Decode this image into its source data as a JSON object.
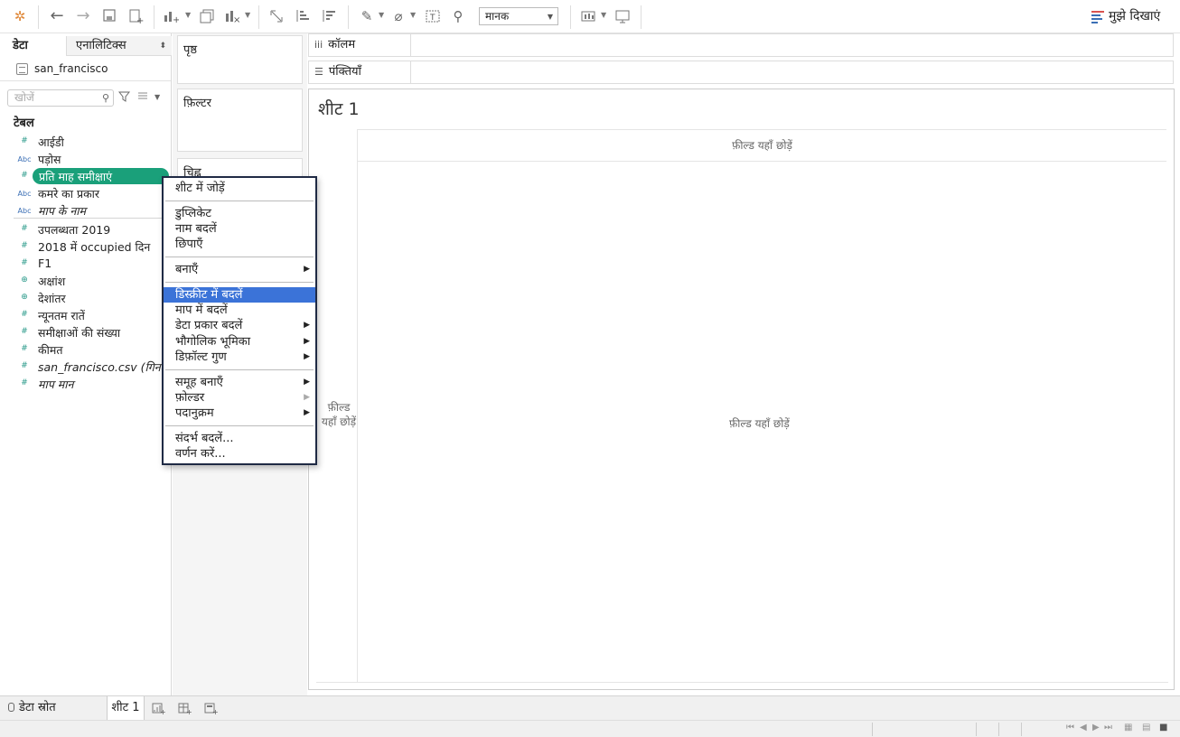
{
  "toolbar": {
    "standard_select": "मानक",
    "show_me_label": "मुझे दिखाएं",
    "icons": [
      "tableau-logo-icon",
      "undo-icon",
      "redo-icon",
      "save-icon",
      "new-datasource-icon",
      "new-worksheet-icon",
      "duplicate-sheet-icon",
      "clear-sheet-icon",
      "swap-icon",
      "sort-ascending-icon",
      "sort-descending-icon",
      "highlight-icon",
      "group-icon",
      "label-icon",
      "pin-icon",
      "fit-icon",
      "presentation-icon"
    ]
  },
  "data_pane": {
    "tab_data": "डेटा",
    "tab_analytics": "एनालिटिक्स",
    "datasource": "san_francisco",
    "search_placeholder": "खोजें",
    "tables_heading": "टेबल",
    "fields": [
      {
        "label": "आईडी",
        "type": "#"
      },
      {
        "label": "पड़ोस",
        "type": "Abc"
      },
      {
        "label": "प्रति माह समीक्षाएं",
        "type": "#"
      },
      {
        "label": "कमरे का प्रकार",
        "type": "Abc"
      },
      {
        "label": "माप के नाम",
        "type": "Abc"
      },
      {
        "label": "उपलब्धता 2019",
        "type": "#"
      },
      {
        "label": "2018 में occupied दिन",
        "type": "#"
      },
      {
        "label": "F1",
        "type": "#"
      },
      {
        "label": "अक्षांश",
        "type": "globe"
      },
      {
        "label": "देशांतर",
        "type": "globe"
      },
      {
        "label": "न्यूनतम रातें",
        "type": "#"
      },
      {
        "label": "समीक्षाओं की संख्या",
        "type": "#"
      },
      {
        "label": "कीमत",
        "type": "#"
      },
      {
        "label": "san_francisco.csv (गिनती)",
        "type": "#"
      },
      {
        "label": "माप मान",
        "type": "#"
      }
    ]
  },
  "cards": {
    "pages": "पृष्ठ",
    "filters": "फ़िल्टर",
    "marks": "चिह्न"
  },
  "shelves": {
    "columns": "कॉलम",
    "rows": "पंक्तियाँ"
  },
  "view": {
    "sheet_title": "शीट 1",
    "drop_top": "फ़ील्ड यहाँ छोड़ें",
    "drop_left": "फ़ील्ड यहाँ छोड़ें",
    "drop_center": "फ़ील्ड यहाँ छोड़ें"
  },
  "context_menu": {
    "items": [
      "शीट में जोड़ें",
      "डुप्लिकेट",
      "नाम बदलें",
      "छिपाएँ",
      "बनाएँ",
      "डिस्क्रीट में बदलें",
      "माप में बदलें",
      "डेटा प्रकार बदलें",
      "भौगोलिक भूमिका",
      "डिफ़ॉल्ट गुण",
      "समूह बनाएँ",
      "फ़ोल्डर",
      "पदानुक्रम",
      "संदर्भ बदलें...",
      "वर्णन करें..."
    ],
    "highlighted": "डिस्क्रीट में बदलें"
  },
  "bottom_tabs": {
    "data_source": "डेटा स्रोत",
    "sheet1": "शीट 1"
  },
  "colors": {
    "selected_field": "#1aa07a",
    "menu_highlight": "#3b73d8",
    "menu_border": "#1f2a44"
  }
}
